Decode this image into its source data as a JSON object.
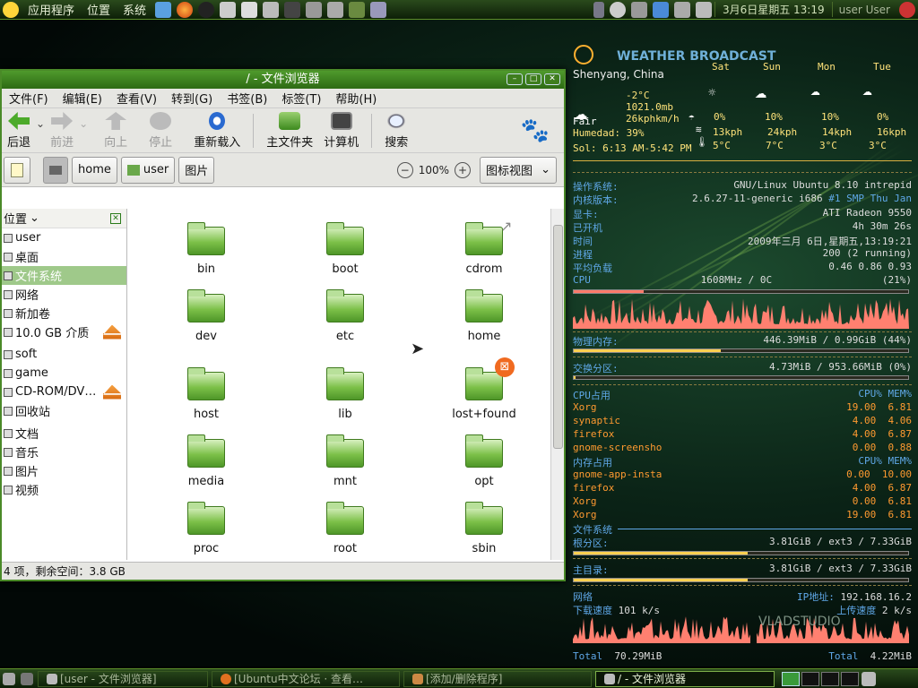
{
  "top_panel": {
    "menus": [
      "应用程序",
      "位置",
      "系统"
    ],
    "clock": "3月6日星期五 13:19",
    "user_label": "user",
    "user_name": "User"
  },
  "window": {
    "title": "/ - 文件浏览器",
    "menus": [
      "文件(F)",
      "编辑(E)",
      "查看(V)",
      "转到(G)",
      "书签(B)",
      "标签(T)",
      "帮助(H)"
    ],
    "toolbar": {
      "back": "后退",
      "forward": "前进",
      "up": "向上",
      "stop": "停止",
      "reload": "重新载入",
      "home": "主文件夹",
      "computer": "计算机",
      "search": "搜索"
    },
    "path": [
      "home",
      "user",
      "图片"
    ],
    "zoom": "100%",
    "view_mode": "图标视图",
    "sidebar": {
      "header": "位置",
      "items": [
        "user",
        "桌面",
        "文件系统",
        "网络",
        "新加卷",
        "10.0 GB 介质",
        "soft",
        "game",
        "CD-ROM/DV…",
        "回收站",
        "文档",
        "音乐",
        "图片",
        "视频"
      ]
    },
    "files": [
      "bin",
      "boot",
      "cdrom",
      "dev",
      "etc",
      "home",
      "host",
      "lib",
      "lost+found",
      "media",
      "mnt",
      "opt",
      "proc",
      "root",
      "sbin"
    ],
    "status": "4 项，剩余空间：3.8 GB"
  },
  "weather": {
    "title": "WEATHER BROADCAST",
    "location": "Shenyang, China",
    "current": {
      "temp": "-2°C",
      "pressure": "1021.0mb",
      "wind": "26kphkm/h",
      "condition": "Fair",
      "humidity": "Humedad: 39%",
      "sun": "Sol: 6:13 AM-5:42 PM"
    },
    "days": [
      "Sat",
      "Sun",
      "Mon",
      "Tue"
    ],
    "precip": [
      "0%",
      "10%",
      "10%",
      "0%"
    ],
    "wind": [
      "13kph",
      "24kph",
      "14kph",
      "16kph"
    ],
    "temps": [
      "5°C",
      "7°C",
      "3°C",
      "3°C"
    ]
  },
  "system": {
    "os_label": "操作系统:",
    "os": "GNU/Linux Ubuntu 8.10 intrepid",
    "kernel_label": "内核版本:",
    "kernel": "2.6.27-11-generic i686",
    "kernel_extra": "#1 SMP Thu Jan",
    "gfx_label": "显卡:",
    "gfx": "ATI Radeon 9550",
    "uptime_label": "已开机",
    "uptime": "4h 30m 26s",
    "time_label": "时间",
    "time": "2009年三月 6日,星期五,13:19:21",
    "proc_label": "进程",
    "proc": "200 (2 running)",
    "load_label": "平均负载",
    "load": "0.46 0.86 0.93",
    "cpu_label": "CPU",
    "cpu_freq": "1608MHz / 0C",
    "cpu_pct": "(21%)",
    "cpu_fill": 0.21
  },
  "memory": {
    "phys_label": "物理内存:",
    "phys": "446.39MiB / 0.99GiB (44%)",
    "phys_fill": 0.44,
    "swap_label": "交换分区:",
    "swap": "4.73MiB / 953.66MiB (0%)",
    "swap_fill": 0.005
  },
  "top_cpu": {
    "label": "CPU占用",
    "col1": "CPU%",
    "col2": "MEM%",
    "rows": [
      {
        "name": "Xorg",
        "cpu": "19.00",
        "mem": "6.81"
      },
      {
        "name": "synaptic",
        "cpu": "4.00",
        "mem": "4.06"
      },
      {
        "name": "firefox",
        "cpu": "4.00",
        "mem": "6.87"
      },
      {
        "name": "gnome-screensho",
        "cpu": "0.00",
        "mem": "0.88"
      }
    ]
  },
  "top_mem": {
    "label": "内存占用",
    "col1": "CPU%",
    "col2": "MEM%",
    "rows": [
      {
        "name": "gnome-app-insta",
        "cpu": "0.00",
        "mem": "10.00"
      },
      {
        "name": "firefox",
        "cpu": "4.00",
        "mem": "6.87"
      },
      {
        "name": "Xorg",
        "cpu": "0.00",
        "mem": "6.81"
      },
      {
        "name": "Xorg",
        "cpu": "19.00",
        "mem": "6.81"
      }
    ]
  },
  "fs": {
    "label": "文件系统",
    "root_label": "根分区:",
    "root": "3.81GiB / ext3 / 7.33GiB",
    "root_fill": 0.52,
    "home_label": "主目录:",
    "home": "3.81GiB / ext3 / 7.33GiB",
    "home_fill": 0.52
  },
  "net": {
    "label": "网络",
    "ip_label": "IP地址:",
    "ip": "192.168.16.2",
    "down_label": "下载速度",
    "down": "101 k/s",
    "up_label": "上传速度",
    "up": "2 k/s",
    "total_label": "Total",
    "total_down": "70.29MiB",
    "total_up": "4.22MiB"
  },
  "watermark": "VLADSTUDIO",
  "taskbar": [
    "[user - 文件浏览器]",
    "[Ubuntu中文论坛 · 查看…",
    "[添加/删除程序]",
    "/ - 文件浏览器"
  ],
  "colors": {
    "accent": "#4a8a28",
    "selection": "#9fc98a",
    "conky_yellow": "#ffe37a",
    "conky_blue": "#5fa8e8",
    "graph": "#ff8070"
  }
}
